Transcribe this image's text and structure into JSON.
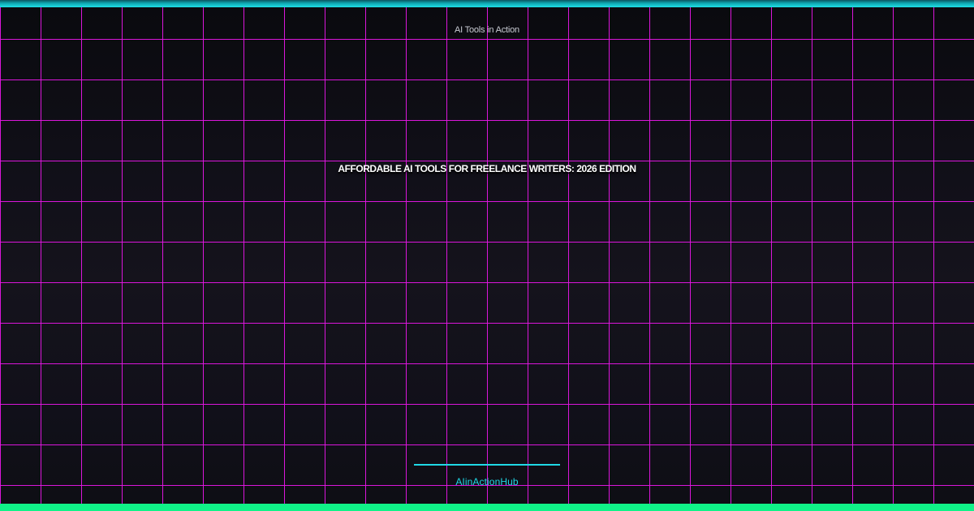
{
  "banner": {
    "eyebrow": "AI Tools in Action",
    "title": "AFFORDABLE AI TOOLS FOR FREELANCE WRITERS: 2026 EDITION",
    "brand": "AIinActionHub"
  },
  "colors": {
    "accent_cyan": "#1fd9e6",
    "accent_green": "#10f288",
    "grid_magenta": "#e516e5",
    "background_dark": "#101018",
    "title_text": "#ffffff",
    "eyebrow_text": "#c9ccd4"
  }
}
